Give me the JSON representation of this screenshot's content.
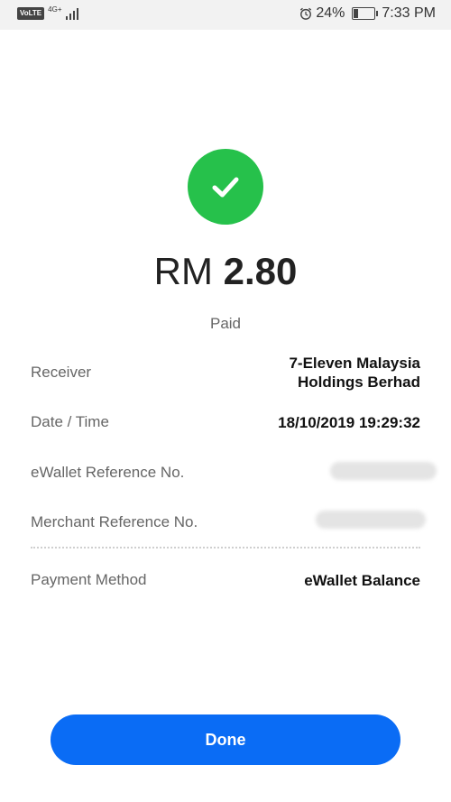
{
  "status_bar": {
    "volte": "VoLTE",
    "network": "4G+",
    "battery_text": "24%",
    "battery_level": 0.24,
    "time": "7:33 PM"
  },
  "receipt": {
    "currency": "RM",
    "amount": "2.80",
    "status": "Paid",
    "success_color": "#26c14b",
    "rows": {
      "receiver_label": "Receiver",
      "receiver_value_line1": "7-Eleven Malaysia",
      "receiver_value_line2": "Holdings Berhad",
      "datetime_label": "Date / Time",
      "datetime_value": "18/10/2019 19:29:32",
      "ewallet_ref_label": "eWallet Reference No.",
      "merchant_ref_label": "Merchant Reference No.",
      "payment_method_label": "Payment Method",
      "payment_method_value": "eWallet Balance"
    }
  },
  "actions": {
    "done_label": "Done",
    "button_color": "#0a6cf5"
  }
}
